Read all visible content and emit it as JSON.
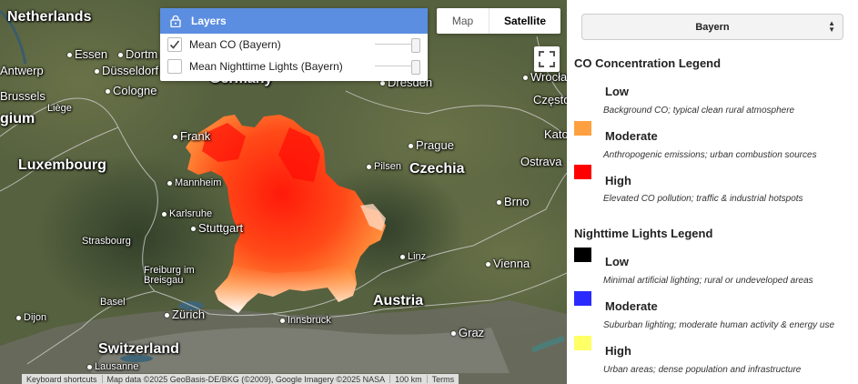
{
  "map": {
    "cities": [
      {
        "name": "Netherlands",
        "cls": "l",
        "dot": false
      },
      {
        "name": "Essen",
        "cls": "m",
        "dot": true
      },
      {
        "name": "Dortm",
        "cls": "m",
        "dot": true
      },
      {
        "name": "Antwerp",
        "cls": "m",
        "dot": false
      },
      {
        "name": "Düsseldorf",
        "cls": "m",
        "dot": true
      },
      {
        "name": "Cologne",
        "cls": "m",
        "dot": true
      },
      {
        "name": "Brussels",
        "cls": "m",
        "dot": false
      },
      {
        "name": "Liège",
        "cls": "s",
        "dot": false
      },
      {
        "name": "gium",
        "cls": "l",
        "dot": false
      },
      {
        "name": "Frank",
        "cls": "m",
        "dot": true
      },
      {
        "name": "Luxembourg",
        "cls": "l",
        "dot": false
      },
      {
        "name": "Mannheim",
        "cls": "s",
        "dot": true
      },
      {
        "name": "Karlsruhe",
        "cls": "s",
        "dot": true
      },
      {
        "name": "Stuttgart",
        "cls": "m",
        "dot": true
      },
      {
        "name": "Strasbourg",
        "cls": "s",
        "dot": false
      },
      {
        "name": "Freiburg im\nBreisgau",
        "cls": "s",
        "dot": false
      },
      {
        "name": "Basel",
        "cls": "s",
        "dot": false
      },
      {
        "name": "Dijon",
        "cls": "s",
        "dot": true
      },
      {
        "name": "Zürich",
        "cls": "m",
        "dot": true
      },
      {
        "name": "Switzerland",
        "cls": "l",
        "dot": false
      },
      {
        "name": "Lausanne",
        "cls": "s",
        "dot": true
      },
      {
        "name": "Germany",
        "cls": "l",
        "dot": false
      },
      {
        "name": "Dresden",
        "cls": "m",
        "dot": true
      },
      {
        "name": "Wrocław",
        "cls": "m",
        "dot": true
      },
      {
        "name": "Częstoc",
        "cls": "m",
        "dot": false
      },
      {
        "name": "Prague",
        "cls": "m",
        "dot": true
      },
      {
        "name": "Pilsen",
        "cls": "s",
        "dot": true
      },
      {
        "name": "Czechia",
        "cls": "l",
        "dot": false
      },
      {
        "name": "Kato",
        "cls": "m",
        "dot": false
      },
      {
        "name": "Ostrava",
        "cls": "m",
        "dot": false
      },
      {
        "name": "Brno",
        "cls": "m",
        "dot": true
      },
      {
        "name": "Linz",
        "cls": "s",
        "dot": true
      },
      {
        "name": "Vienna",
        "cls": "m",
        "dot": true
      },
      {
        "name": "Austria",
        "cls": "l",
        "dot": false
      },
      {
        "name": "Innsbruck",
        "cls": "s",
        "dot": true
      },
      {
        "name": "Graz",
        "cls": "m",
        "dot": true
      }
    ],
    "attribution": {
      "shortcuts": "Keyboard shortcuts",
      "data": "Map data ©2025 GeoBasis-DE/BKG (©2009), Google Imagery ©2025 NASA",
      "scale": "100 km",
      "terms": "Terms"
    }
  },
  "layers_panel": {
    "title": "Layers",
    "items": [
      {
        "label": "Mean CO (Bayern)",
        "checked": true
      },
      {
        "label": "Mean Nighttime Lights (Bayern)",
        "checked": false
      }
    ]
  },
  "map_type": {
    "map_label": "Map",
    "satellite_label": "Satellite",
    "selected": "Satellite"
  },
  "side_panel": {
    "region_select": "Bayern",
    "co_legend": {
      "title": "CO Concentration Legend",
      "items": [
        {
          "label": "Low",
          "desc": "Background CO; typical clean rural atmosphere",
          "color": "#ffffff"
        },
        {
          "label": "Moderate",
          "desc": "Anthropogenic emissions; urban combustion sources",
          "color": "#ffa040"
        },
        {
          "label": "High",
          "desc": "Elevated CO pollution; traffic & industrial hotspots",
          "color": "#ff0000"
        }
      ]
    },
    "ntl_legend": {
      "title": "Nighttime Lights Legend",
      "items": [
        {
          "label": "Low",
          "desc": "Minimal artificial lighting; rural or undeveloped areas",
          "color": "#000000"
        },
        {
          "label": "Moderate",
          "desc": "Suburban lighting; moderate human activity & energy use",
          "color": "#2a2aff"
        },
        {
          "label": "High",
          "desc": "Urban areas; dense population and infrastructure",
          "color": "#ffff66"
        }
      ]
    }
  }
}
